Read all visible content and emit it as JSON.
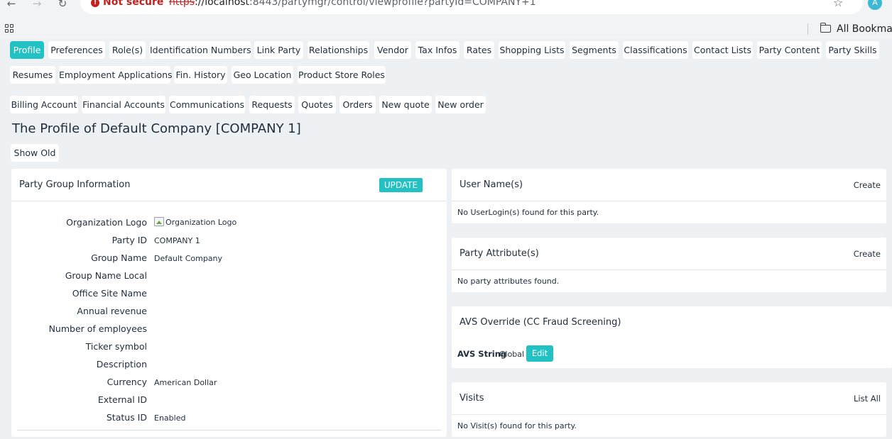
{
  "browser": {
    "not_secure_label": "Not secure",
    "url_scheme": "https",
    "url_host": "://localhost",
    "url_path": ":8443/partymgr/control/viewprofile?partyId=COMPANY+1",
    "avatar_letter": "A",
    "bookmarks_label": "All Bookma",
    "icons": [
      "back-arrow-icon",
      "forward-arrow-icon",
      "reload-icon",
      "not-secure-icon",
      "star-icon",
      "apps-icon",
      "folder-icon"
    ]
  },
  "tabs_row1": [
    "Profile",
    "Preferences",
    "Role(s)",
    "Identification Numbers",
    "Link Party",
    "Relationships",
    "Vendor",
    "Tax Infos",
    "Rates",
    "Shopping Lists",
    "Segments",
    "Classifications",
    "Contact Lists",
    "Party Content",
    "Party Skills"
  ],
  "tabs_row2": [
    "Resumes",
    "Employment Applications",
    "Fin. History",
    "Geo Location",
    "Product Store Roles"
  ],
  "tabs_row3": [
    "Billing Account",
    "Financial Accounts",
    "Communications",
    "Requests",
    "Quotes",
    "Orders",
    "New quote",
    "New order"
  ],
  "active_tab": "Profile",
  "page_title": "The Profile of Default Company [COMPANY 1]",
  "show_old_label": "Show Old",
  "party_group": {
    "title": "Party Group Information",
    "update_label": "UPDATE",
    "fields": [
      {
        "label": "Organization Logo",
        "value": "Organization Logo"
      },
      {
        "label": "Party ID",
        "value": "COMPANY 1"
      },
      {
        "label": "Group Name",
        "value": "Default Company"
      },
      {
        "label": "Group Name Local",
        "value": ""
      },
      {
        "label": "Office Site Name",
        "value": ""
      },
      {
        "label": "Annual revenue",
        "value": ""
      },
      {
        "label": "Number of employees",
        "value": ""
      },
      {
        "label": "Ticker symbol",
        "value": ""
      },
      {
        "label": "Description",
        "value": ""
      },
      {
        "label": "Currency",
        "value": "American Dollar"
      },
      {
        "label": "External ID",
        "value": ""
      },
      {
        "label": "Status ID",
        "value": "Enabled"
      }
    ]
  },
  "user_names": {
    "title": "User Name(s)",
    "link": "Create",
    "message": "No UserLogin(s) found for this party."
  },
  "party_attributes": {
    "title": "Party Attribute(s)",
    "link": "Create",
    "message": "No party attributes found."
  },
  "avs_override": {
    "title": "AVS Override (CC Fraud Screening)",
    "label": "AVS String",
    "value": "Global",
    "edit_label": "Edit"
  },
  "visits": {
    "title": "Visits",
    "link": "List All",
    "message": "No Visit(s) found for this party."
  },
  "colors": {
    "accent": "#22c1c3",
    "page_bg": "#eef1f4",
    "panel_bg": "#ffffff",
    "text": "#1f2d3d",
    "not_secure": "#c5221f"
  }
}
